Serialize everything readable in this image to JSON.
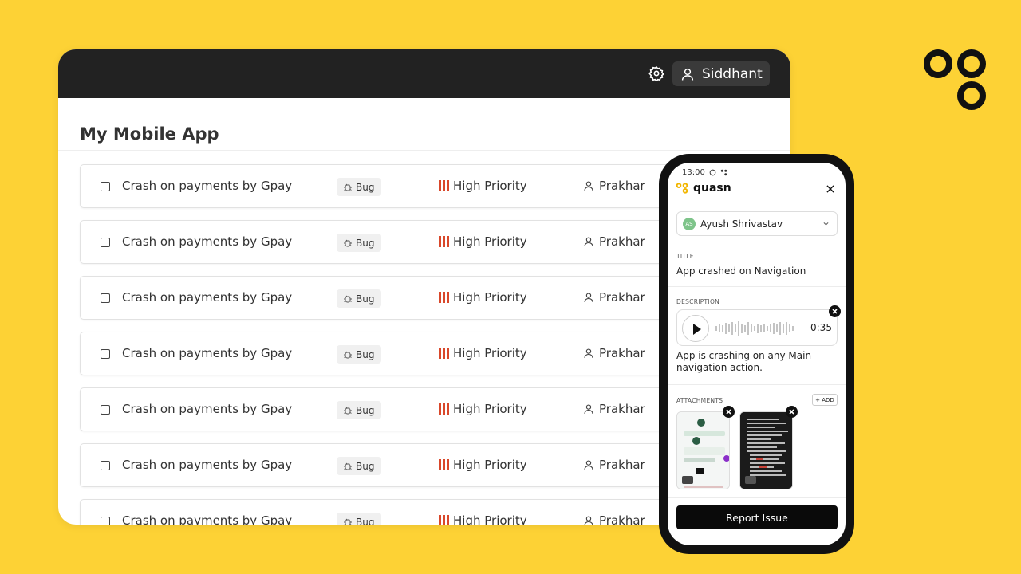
{
  "header": {
    "username": "Siddhant"
  },
  "page": {
    "title": "My Mobile App"
  },
  "issues": [
    {
      "title": "Crash on payments by Gpay",
      "type": "Bug",
      "priority": "High Priority",
      "assignee": "Prakhar"
    },
    {
      "title": "Crash on payments by Gpay",
      "type": "Bug",
      "priority": "High Priority",
      "assignee": "Prakhar"
    },
    {
      "title": "Crash on payments by Gpay",
      "type": "Bug",
      "priority": "High Priority",
      "assignee": "Prakhar"
    },
    {
      "title": "Crash on payments by Gpay",
      "type": "Bug",
      "priority": "High Priority",
      "assignee": "Prakhar"
    },
    {
      "title": "Crash on payments by Gpay",
      "type": "Bug",
      "priority": "High Priority",
      "assignee": "Prakhar"
    },
    {
      "title": "Crash on payments by Gpay",
      "type": "Bug",
      "priority": "High Priority",
      "assignee": "Prakhar"
    },
    {
      "title": "Crash on payments by Gpay",
      "type": "Bug",
      "priority": "High Priority",
      "assignee": "Prakhar"
    }
  ],
  "phone": {
    "status_time": "13:00",
    "app_name": "quasn",
    "reporter": {
      "initials": "AS",
      "name": "Ayush Shrivastav"
    },
    "title_label": "TITLE",
    "title_value": "App crashed on Navigation",
    "description_label": "DESCRIPTION",
    "audio_duration": "0:35",
    "description_text": "App is crashing on any Main navigation action.",
    "attachments_label": "ATTACHMENTS",
    "add_label": "+ ADD",
    "report_button": "Report Issue"
  },
  "colors": {
    "background": "#FDD235",
    "topbar": "#222222",
    "priority": "#d9482b",
    "button": "#0a0a0a"
  },
  "icons": [
    "brand-mark-icon",
    "gear-icon",
    "user-icon",
    "checkbox-icon",
    "bug-icon",
    "priority-bars-icon",
    "close-icon",
    "chevron-down-icon",
    "play-icon",
    "waveform-icon"
  ]
}
